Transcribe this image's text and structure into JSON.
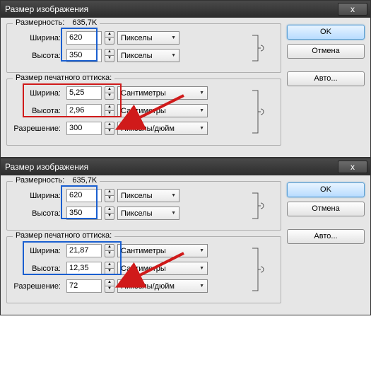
{
  "dialogs": [
    {
      "title": "Размер изображения",
      "close": "x",
      "buttons": {
        "ok": "OK",
        "cancel": "Отмена",
        "auto": "Авто..."
      },
      "dimensions": {
        "legend": "Размерность:",
        "value": "635,7K",
        "width_lbl": "Ширина:",
        "width_val": "620",
        "width_unit": "Пикселы",
        "height_lbl": "Высота:",
        "height_val": "350",
        "height_unit": "Пикселы"
      },
      "print": {
        "legend": "Размер печатного оттиска:",
        "width_lbl": "Ширина:",
        "width_val": "5,25",
        "width_unit": "Сантиметры",
        "height_lbl": "Высота:",
        "height_val": "2,96",
        "height_unit": "Сантиметры",
        "res_lbl": "Разрешение:",
        "res_val": "300",
        "res_unit": "Пикселы/дюйм"
      }
    },
    {
      "title": "Размер изображения",
      "close": "x",
      "buttons": {
        "ok": "OK",
        "cancel": "Отмена",
        "auto": "Авто..."
      },
      "dimensions": {
        "legend": "Размерность:",
        "value": "635,7K",
        "width_lbl": "Ширина:",
        "width_val": "620",
        "width_unit": "Пикселы",
        "height_lbl": "Высота:",
        "height_val": "350",
        "height_unit": "Пикселы"
      },
      "print": {
        "legend": "Размер печатного оттиска:",
        "width_lbl": "Ширина:",
        "width_val": "21,87",
        "width_unit": "Сантиметры",
        "height_lbl": "Высота:",
        "height_val": "12,35",
        "height_unit": "Сантиметры",
        "res_lbl": "Разрешение:",
        "res_val": "72",
        "res_unit": "Пикселы/дюйм"
      }
    }
  ]
}
